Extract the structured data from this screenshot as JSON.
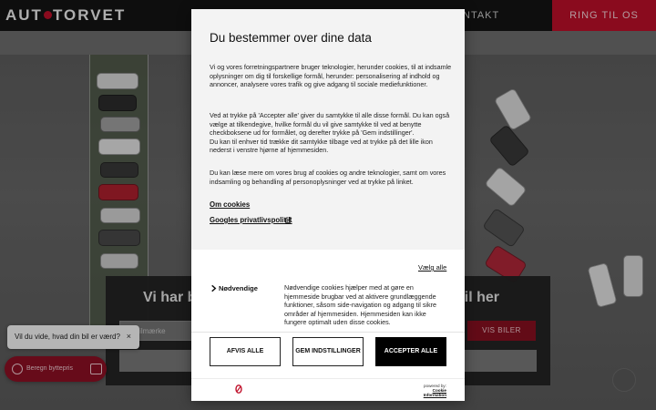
{
  "header": {
    "logo": "AUT TORVET",
    "logo_left": "AUT",
    "logo_right": "TORVET",
    "nav_contact": "NTAKT",
    "call_button": "RING TIL OS"
  },
  "hero": {
    "title_left": "Vi har b",
    "title_right": "bil her",
    "brand_placeholder": "g bilmærke",
    "search_button": "VIS BILER"
  },
  "valuation": {
    "bubble_text": "Vil du vide, hvad din bil er værd?",
    "close_label": "×",
    "button_label": "Beregn byttepris"
  },
  "consent": {
    "title": "Du bestemmer over dine data",
    "paragraph1": "Vi og vores forretningspartnere bruger teknologier, herunder cookies, til at indsamle oplysninger om dig til forskellige formål, herunder: personalisering af indhold og annoncer, analysere vores trafik og give adgang til sociale mediefunktioner.",
    "paragraph2": "Ved at trykke på 'Accepter alle' giver du samtykke til alle disse formål. Du kan også vælge at tilkendegive, hvilke formål du vil give samtykke til ved at benytte checkboksene ud for formålet, og derefter trykke på 'Gem indstillinger'.",
    "paragraph2b": "Du kan til enhver tid trække dit samtykke tilbage ved at trykke på det lille ikon nederst i venstre hjørne af hjemmesiden.",
    "paragraph3": "Du kan læse mere om vores brug af cookies og andre teknologier, samt om vores indsamling og behandling af personoplysninger ved at trykke på linket.",
    "link_cookies": "Om cookies",
    "link_google": "Googles privatlivspolitik",
    "select_all": "Vælg alle",
    "necessary_label": "Nødvendige",
    "necessary_desc": "Nødvendige cookies hjælper med at gøre en hjemmeside brugbar ved at aktivere grundlæggende funktioner, såsom side-navigation og adgang til sikre områder af hjemmesiden. Hjemmesiden kan ikke fungere optimalt uden disse cookies.",
    "btn_reject": "AFVIS ALLE",
    "btn_save": "GEM INDSTILLINGER",
    "btn_accept": "ACCEPTER ALLE",
    "powered_by": "powered by:",
    "powered_name": "Cookie Information"
  },
  "colors": {
    "brand_red": "#c0102a",
    "dialog_bg": "#ffffff",
    "accept_bg": "#000000"
  }
}
